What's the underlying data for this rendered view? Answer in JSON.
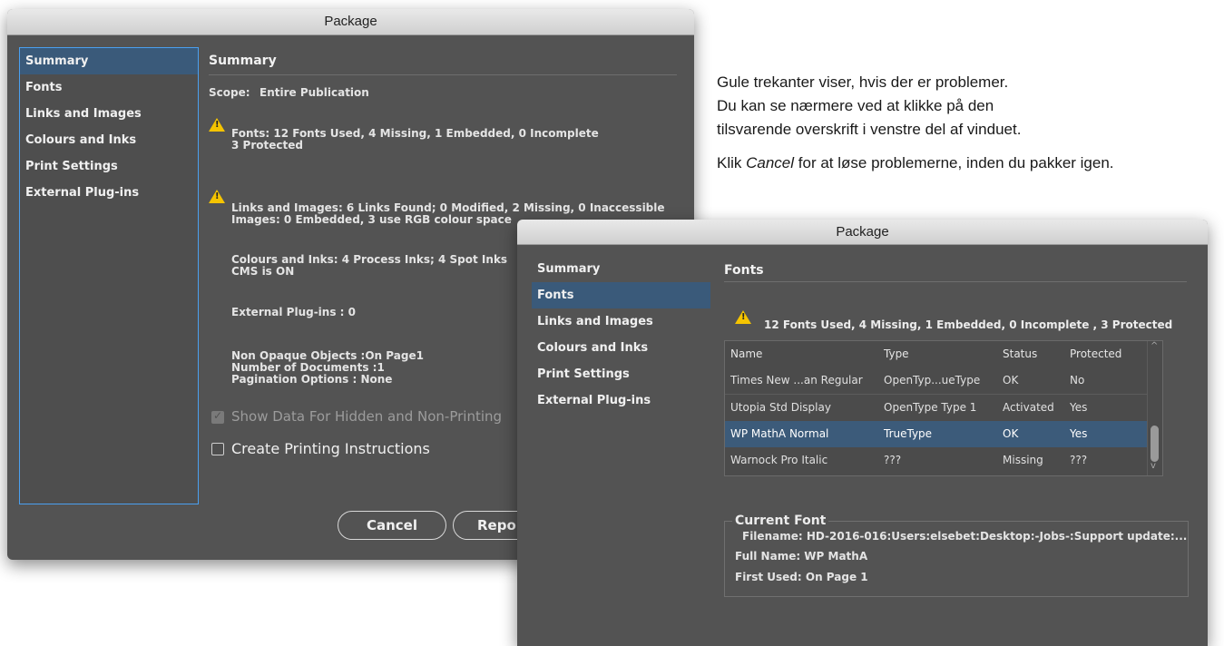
{
  "dialog1": {
    "title": "Package",
    "sidebar": [
      "Summary",
      "Fonts",
      "Links and Images",
      "Colours and Inks",
      "Print Settings",
      "External Plug-ins"
    ],
    "section_title": "Summary",
    "scope_label": "Scope:",
    "scope_value": "Entire Publication",
    "fonts_line1": "Fonts: 12 Fonts Used, 4 Missing, 1 Embedded, 0 Incomplete",
    "fonts_line2": "3 Protected",
    "links_line1": "Links and Images: 6 Links Found; 0 Modified, 2 Missing, 0 Inaccessible",
    "links_line2": "Images: 0 Embedded, 3 use RGB colour space",
    "colours_line1": "Colours and Inks: 4 Process Inks; 4 Spot Inks",
    "colours_line2": "CMS is ON",
    "plugins_line": "External Plug-ins : 0",
    "misc_line1": "Non Opaque Objects :On Page1",
    "misc_line2": "Number of Documents :1",
    "misc_line3": "Pagination Options : None",
    "show_hidden_label": "Show Data For Hidden and Non-Printing",
    "create_instructions_label": "Create Printing Instructions",
    "cancel_label": "Cancel",
    "report_label": "Repor"
  },
  "info_text": {
    "line1": "Gule trekanter viser, hvis der er problemer.",
    "line2": "Du kan se nærmere ved at klikke på den",
    "line3": "tilsvarende overskrift i venstre del af vinduet.",
    "line4_pre": "Klik ",
    "line4_em": "Cancel",
    "line4_post": " for at løse problemerne, inden du pakker igen."
  },
  "dialog2": {
    "title": "Package",
    "sidebar": [
      "Summary",
      "Fonts",
      "Links and Images",
      "Colours and Inks",
      "Print Settings",
      "External Plug-ins"
    ],
    "section_title": "Fonts",
    "fonts_summary": "12 Fonts Used, 4 Missing, 1 Embedded, 0 Incomplete , 3 Protected",
    "table": {
      "columns": [
        "Name",
        "Type",
        "Status",
        "Protected"
      ],
      "rows": [
        [
          "Times New ...an Regular",
          "OpenTyp...ueType",
          "OK",
          "No"
        ],
        [
          "Utopia Std Display",
          "OpenType Type 1",
          "Activated",
          "Yes"
        ],
        [
          "WP MathA Normal",
          "TrueType",
          "OK",
          "Yes"
        ],
        [
          "Warnock Pro Italic",
          "???",
          "Missing",
          "???"
        ]
      ]
    },
    "current_font": {
      "title": "Current Font",
      "filename": "Filename: HD-2016-016:Users:elsebet:Desktop:-Jobs-:Support update:...",
      "full_name": "Full Name: WP MathA",
      "first_used": "First Used: On Page 1"
    }
  },
  "colors": {
    "dialog_bg": "#535353",
    "selection": "#3c5b7a",
    "warning": "#f5c400",
    "focus_border": "#4aa0f0"
  }
}
